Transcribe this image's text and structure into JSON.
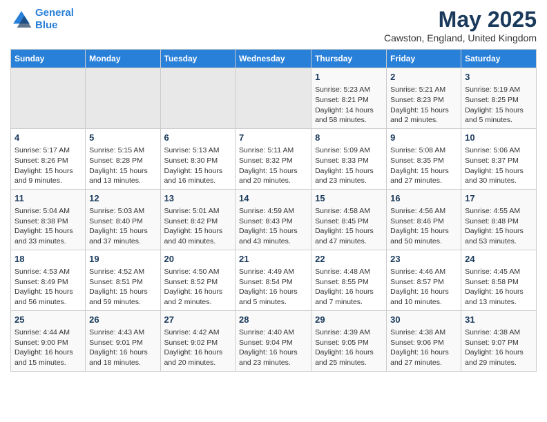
{
  "header": {
    "logo_line1": "General",
    "logo_line2": "Blue",
    "month_title": "May 2025",
    "location": "Cawston, England, United Kingdom"
  },
  "days_of_week": [
    "Sunday",
    "Monday",
    "Tuesday",
    "Wednesday",
    "Thursday",
    "Friday",
    "Saturday"
  ],
  "weeks": [
    [
      {
        "day": "",
        "empty": true
      },
      {
        "day": "",
        "empty": true
      },
      {
        "day": "",
        "empty": true
      },
      {
        "day": "",
        "empty": true
      },
      {
        "day": "1",
        "sunrise": "5:23 AM",
        "sunset": "8:21 PM",
        "daylight": "14 hours and 58 minutes."
      },
      {
        "day": "2",
        "sunrise": "5:21 AM",
        "sunset": "8:23 PM",
        "daylight": "15 hours and 2 minutes."
      },
      {
        "day": "3",
        "sunrise": "5:19 AM",
        "sunset": "8:25 PM",
        "daylight": "15 hours and 5 minutes."
      }
    ],
    [
      {
        "day": "4",
        "sunrise": "5:17 AM",
        "sunset": "8:26 PM",
        "daylight": "15 hours and 9 minutes."
      },
      {
        "day": "5",
        "sunrise": "5:15 AM",
        "sunset": "8:28 PM",
        "daylight": "15 hours and 13 minutes."
      },
      {
        "day": "6",
        "sunrise": "5:13 AM",
        "sunset": "8:30 PM",
        "daylight": "15 hours and 16 minutes."
      },
      {
        "day": "7",
        "sunrise": "5:11 AM",
        "sunset": "8:32 PM",
        "daylight": "15 hours and 20 minutes."
      },
      {
        "day": "8",
        "sunrise": "5:09 AM",
        "sunset": "8:33 PM",
        "daylight": "15 hours and 23 minutes."
      },
      {
        "day": "9",
        "sunrise": "5:08 AM",
        "sunset": "8:35 PM",
        "daylight": "15 hours and 27 minutes."
      },
      {
        "day": "10",
        "sunrise": "5:06 AM",
        "sunset": "8:37 PM",
        "daylight": "15 hours and 30 minutes."
      }
    ],
    [
      {
        "day": "11",
        "sunrise": "5:04 AM",
        "sunset": "8:38 PM",
        "daylight": "15 hours and 33 minutes."
      },
      {
        "day": "12",
        "sunrise": "5:03 AM",
        "sunset": "8:40 PM",
        "daylight": "15 hours and 37 minutes."
      },
      {
        "day": "13",
        "sunrise": "5:01 AM",
        "sunset": "8:42 PM",
        "daylight": "15 hours and 40 minutes."
      },
      {
        "day": "14",
        "sunrise": "4:59 AM",
        "sunset": "8:43 PM",
        "daylight": "15 hours and 43 minutes."
      },
      {
        "day": "15",
        "sunrise": "4:58 AM",
        "sunset": "8:45 PM",
        "daylight": "15 hours and 47 minutes."
      },
      {
        "day": "16",
        "sunrise": "4:56 AM",
        "sunset": "8:46 PM",
        "daylight": "15 hours and 50 minutes."
      },
      {
        "day": "17",
        "sunrise": "4:55 AM",
        "sunset": "8:48 PM",
        "daylight": "15 hours and 53 minutes."
      }
    ],
    [
      {
        "day": "18",
        "sunrise": "4:53 AM",
        "sunset": "8:49 PM",
        "daylight": "15 hours and 56 minutes."
      },
      {
        "day": "19",
        "sunrise": "4:52 AM",
        "sunset": "8:51 PM",
        "daylight": "15 hours and 59 minutes."
      },
      {
        "day": "20",
        "sunrise": "4:50 AM",
        "sunset": "8:52 PM",
        "daylight": "16 hours and 2 minutes."
      },
      {
        "day": "21",
        "sunrise": "4:49 AM",
        "sunset": "8:54 PM",
        "daylight": "16 hours and 5 minutes."
      },
      {
        "day": "22",
        "sunrise": "4:48 AM",
        "sunset": "8:55 PM",
        "daylight": "16 hours and 7 minutes."
      },
      {
        "day": "23",
        "sunrise": "4:46 AM",
        "sunset": "8:57 PM",
        "daylight": "16 hours and 10 minutes."
      },
      {
        "day": "24",
        "sunrise": "4:45 AM",
        "sunset": "8:58 PM",
        "daylight": "16 hours and 13 minutes."
      }
    ],
    [
      {
        "day": "25",
        "sunrise": "4:44 AM",
        "sunset": "9:00 PM",
        "daylight": "16 hours and 15 minutes."
      },
      {
        "day": "26",
        "sunrise": "4:43 AM",
        "sunset": "9:01 PM",
        "daylight": "16 hours and 18 minutes."
      },
      {
        "day": "27",
        "sunrise": "4:42 AM",
        "sunset": "9:02 PM",
        "daylight": "16 hours and 20 minutes."
      },
      {
        "day": "28",
        "sunrise": "4:40 AM",
        "sunset": "9:04 PM",
        "daylight": "16 hours and 23 minutes."
      },
      {
        "day": "29",
        "sunrise": "4:39 AM",
        "sunset": "9:05 PM",
        "daylight": "16 hours and 25 minutes."
      },
      {
        "day": "30",
        "sunrise": "4:38 AM",
        "sunset": "9:06 PM",
        "daylight": "16 hours and 27 minutes."
      },
      {
        "day": "31",
        "sunrise": "4:38 AM",
        "sunset": "9:07 PM",
        "daylight": "16 hours and 29 minutes."
      }
    ]
  ],
  "labels": {
    "sunrise_prefix": "Sunrise: ",
    "sunset_prefix": "Sunset: ",
    "daylight_label": "Daylight: "
  }
}
